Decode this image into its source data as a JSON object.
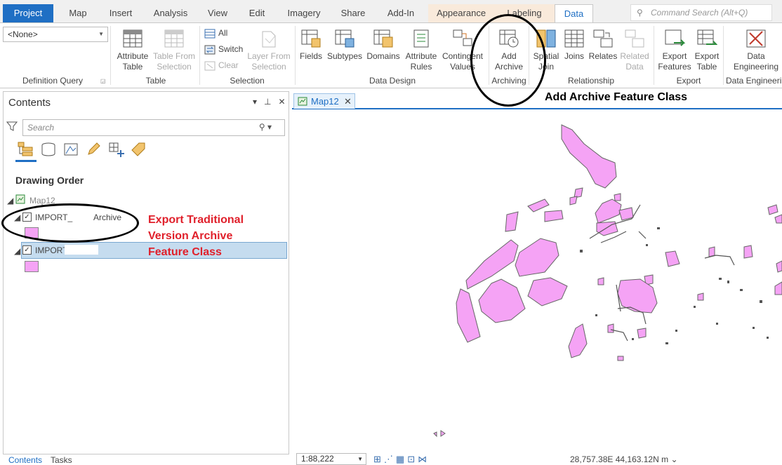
{
  "ribbon_tabs": [
    "Project",
    "Map",
    "Insert",
    "Analysis",
    "View",
    "Edit",
    "Imagery",
    "Share",
    "Add-In",
    "Appearance",
    "Labeling",
    "Data"
  ],
  "command_search": {
    "placeholder": "Command Search (Alt+Q)"
  },
  "groups": {
    "definition_query": {
      "label": "Definition Query",
      "value": "<None>"
    },
    "table": {
      "label": "Table",
      "buttons": [
        "Attribute\nTable",
        "Table From\nSelection"
      ]
    },
    "selection": {
      "label": "Selection",
      "buttons": [
        "All",
        "Switch",
        "Clear",
        "Layer From\nSelection"
      ]
    },
    "data_design": {
      "label": "Data Design",
      "buttons": [
        "Fields",
        "Subtypes",
        "Domains",
        "Attribute\nRules",
        "Contingent\nValues"
      ]
    },
    "archiving": {
      "label": "Archiving",
      "buttons": [
        "Add\nArchive"
      ]
    },
    "relationship": {
      "label": "Relationship",
      "buttons": [
        "Spatial\nJoin",
        "Joins",
        "Relates",
        "Related\nData"
      ]
    },
    "export": {
      "label": "Export",
      "buttons": [
        "Export\nFeatures",
        "Export\nTable"
      ]
    },
    "data_engineering": {
      "label": "Data Engineering",
      "buttons": [
        "Data\nEngineering"
      ]
    }
  },
  "contents": {
    "title": "Contents",
    "search_placeholder": "Search",
    "drawing_order": "Drawing Order",
    "map_name": "Map12",
    "layers": [
      {
        "name_prefix": "IMPORT_",
        "name_suffix": "Archive",
        "checked": true
      },
      {
        "name_prefix": "IMPORT",
        "name_suffix": "",
        "checked": true,
        "selected": true
      }
    ],
    "bottom_tabs": [
      "Contents",
      "Tasks"
    ]
  },
  "annotations": {
    "add_archive": "Add Archive Feature Class",
    "export_archive": [
      "Export Traditional",
      "Version Archive",
      "Feature Class"
    ]
  },
  "map": {
    "tab_label": "Map12",
    "scale": "1:88,222",
    "coordinates": "28,757.38E 44,163.12N m",
    "polygon_fill": "#f5a3f5"
  }
}
